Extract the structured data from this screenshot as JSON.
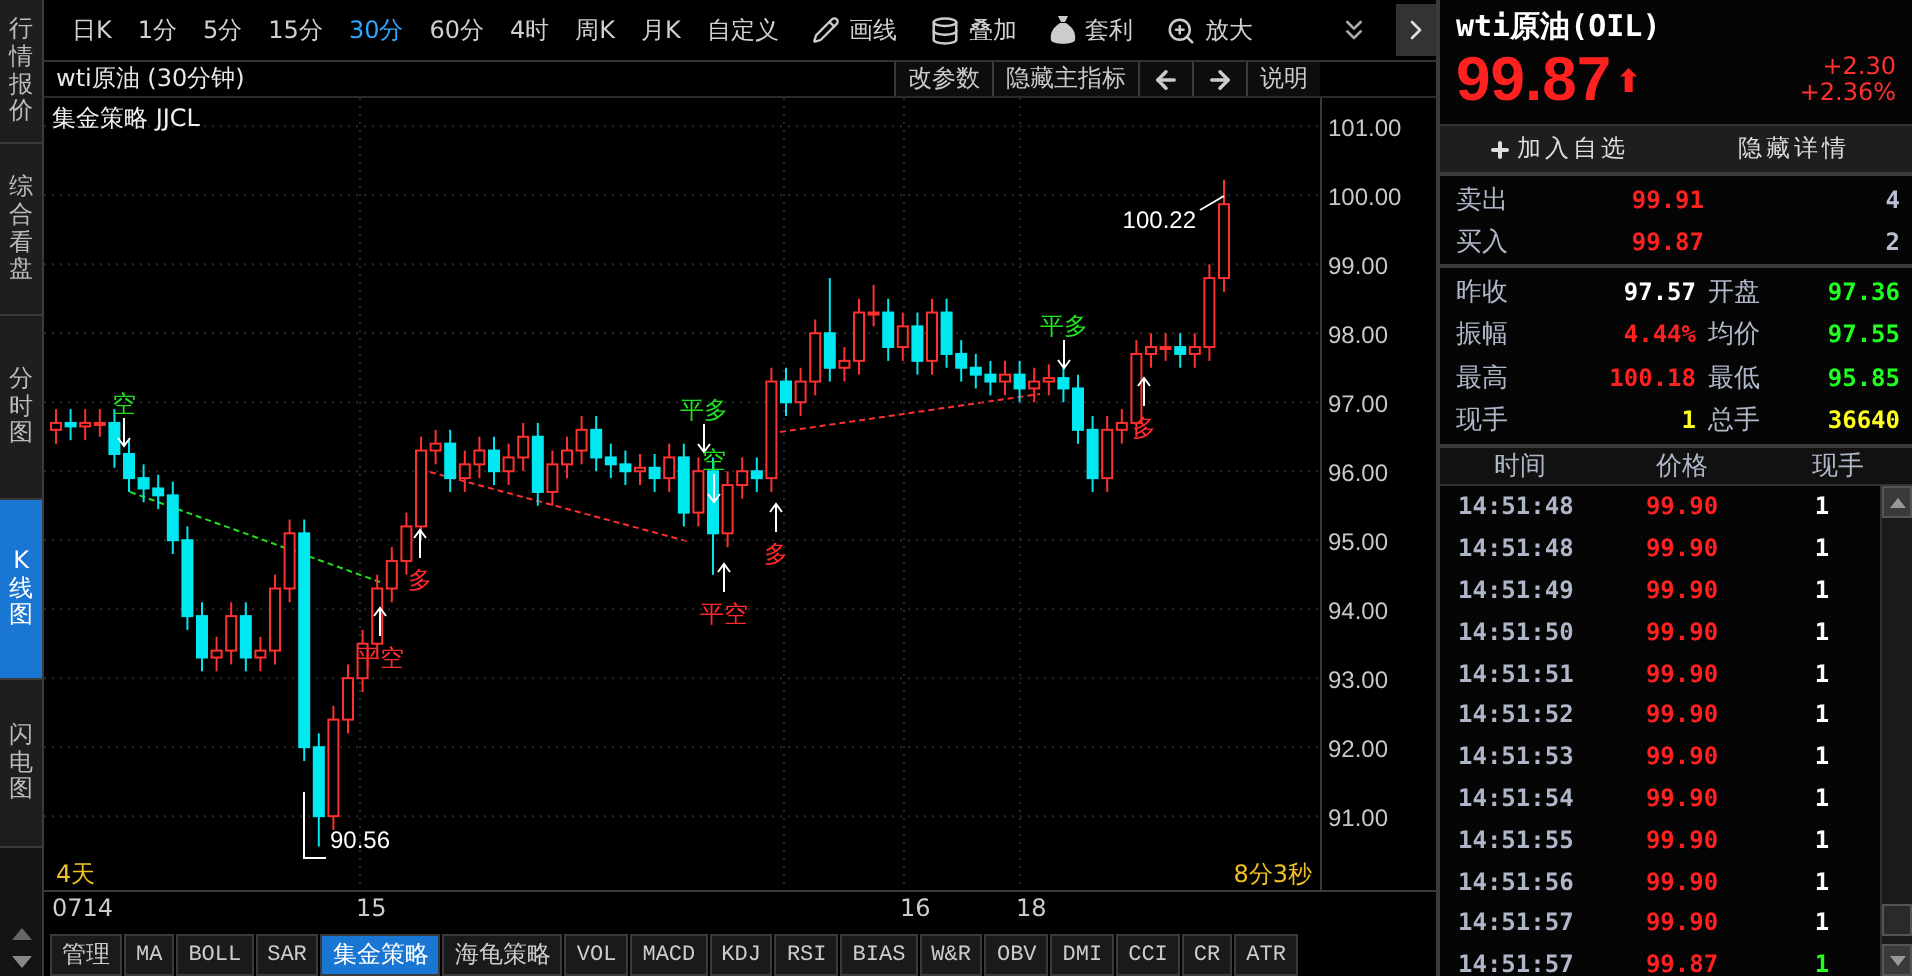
{
  "sidebar_tabs": [
    {
      "label": "行情报价",
      "selected": false
    },
    {
      "label": "综合看盘",
      "selected": false
    },
    {
      "label": "分时图",
      "selected": false
    },
    {
      "label": "K线图",
      "selected": true
    },
    {
      "label": "闪电图",
      "selected": false
    }
  ],
  "periods": [
    {
      "label": "日K",
      "selected": false
    },
    {
      "label": "1分",
      "selected": false
    },
    {
      "label": "5分",
      "selected": false
    },
    {
      "label": "15分",
      "selected": false
    },
    {
      "label": "30分",
      "selected": true
    },
    {
      "label": "60分",
      "selected": false
    },
    {
      "label": "4时",
      "selected": false
    },
    {
      "label": "周K",
      "selected": false
    },
    {
      "label": "月K",
      "selected": false
    },
    {
      "label": "自定义",
      "selected": false
    }
  ],
  "tools": [
    {
      "label": "画线",
      "kind": "pen"
    },
    {
      "label": "叠加",
      "kind": "stack"
    },
    {
      "label": "套利",
      "kind": "bag"
    },
    {
      "label": "放大",
      "kind": "zoom"
    }
  ],
  "chart": {
    "title": "wti原油 (30分钟)",
    "buttons": [
      {
        "kind": "text",
        "label": "改参数"
      },
      {
        "kind": "text",
        "label": "隐藏主指标"
      },
      {
        "kind": "left"
      },
      {
        "kind": "right"
      },
      {
        "kind": "text",
        "label": "说明"
      }
    ],
    "indicator": "集金策略 JJCL",
    "high_label": "100.22",
    "low_label": "90.56",
    "signals": [
      {
        "text": "空",
        "kind": "sell"
      },
      {
        "text": "平空",
        "kind": "buy"
      },
      {
        "text": "多",
        "kind": "buy"
      },
      {
        "text": "平多",
        "kind": "sell"
      },
      {
        "text": "空",
        "kind": "sell"
      },
      {
        "text": "平空",
        "kind": "buy"
      },
      {
        "text": "多",
        "kind": "buy"
      },
      {
        "text": "平多",
        "kind": "sell"
      },
      {
        "text": "多",
        "kind": "buy"
      }
    ],
    "span": "4天",
    "countdown": "8分3秒",
    "dates": [
      "0714",
      "15",
      "16",
      "18"
    ],
    "chart_data": {
      "type": "candlestick",
      "grid": true,
      "ylim": [
        89.93,
        101.41
      ],
      "ohlc": [
        [
          96.6,
          96.9,
          96.4,
          96.7
        ],
        [
          96.7,
          96.9,
          96.45,
          96.65
        ],
        [
          96.65,
          96.9,
          96.45,
          96.7
        ],
        [
          96.7,
          96.9,
          96.5,
          96.7
        ],
        [
          96.7,
          96.9,
          96.05,
          96.25
        ],
        [
          96.25,
          96.45,
          95.7,
          95.9
        ],
        [
          95.9,
          96.1,
          95.55,
          95.75
        ],
        [
          95.75,
          95.95,
          95.45,
          95.65
        ],
        [
          95.65,
          95.85,
          94.8,
          95.0
        ],
        [
          95.0,
          95.2,
          93.7,
          93.9
        ],
        [
          93.9,
          94.1,
          93.1,
          93.3
        ],
        [
          93.3,
          93.6,
          93.1,
          93.4
        ],
        [
          93.4,
          94.1,
          93.2,
          93.9
        ],
        [
          93.9,
          94.1,
          93.1,
          93.3
        ],
        [
          93.3,
          93.6,
          93.1,
          93.4
        ],
        [
          93.4,
          94.5,
          93.2,
          94.3
        ],
        [
          94.3,
          95.3,
          94.1,
          95.1
        ],
        [
          95.1,
          95.3,
          91.8,
          92.0
        ],
        [
          92.0,
          92.2,
          90.56,
          91.0
        ],
        [
          91.0,
          92.6,
          90.8,
          92.4
        ],
        [
          92.4,
          93.2,
          92.2,
          93.0
        ],
        [
          93.0,
          93.7,
          92.8,
          93.5
        ],
        [
          93.5,
          94.5,
          93.3,
          94.3
        ],
        [
          94.3,
          94.9,
          94.1,
          94.7
        ],
        [
          94.7,
          95.4,
          94.5,
          95.2
        ],
        [
          95.2,
          96.5,
          95.0,
          96.3
        ],
        [
          96.3,
          96.6,
          96.1,
          96.4
        ],
        [
          96.4,
          96.6,
          95.7,
          95.9
        ],
        [
          95.9,
          96.3,
          95.7,
          96.1
        ],
        [
          96.1,
          96.5,
          95.9,
          96.3
        ],
        [
          96.3,
          96.5,
          95.8,
          96.0
        ],
        [
          96.0,
          96.4,
          95.8,
          96.2
        ],
        [
          96.2,
          96.7,
          96.0,
          96.5
        ],
        [
          96.5,
          96.7,
          95.5,
          95.7
        ],
        [
          95.7,
          96.3,
          95.5,
          96.1
        ],
        [
          96.1,
          96.5,
          95.9,
          96.3
        ],
        [
          96.3,
          96.8,
          96.1,
          96.6
        ],
        [
          96.6,
          96.8,
          96.0,
          96.2
        ],
        [
          96.2,
          96.4,
          95.9,
          96.1
        ],
        [
          96.1,
          96.3,
          95.8,
          96.0
        ],
        [
          96.0,
          96.25,
          95.8,
          96.05
        ],
        [
          96.05,
          96.25,
          95.7,
          95.9
        ],
        [
          95.9,
          96.4,
          95.7,
          96.2
        ],
        [
          96.2,
          96.4,
          95.2,
          95.4
        ],
        [
          95.4,
          96.2,
          95.2,
          96.0
        ],
        [
          96.0,
          96.2,
          94.5,
          95.1
        ],
        [
          95.1,
          96.0,
          94.9,
          95.8
        ],
        [
          95.8,
          96.2,
          95.6,
          96.0
        ],
        [
          96.0,
          96.2,
          95.7,
          95.9
        ],
        [
          95.9,
          97.5,
          95.7,
          97.3
        ],
        [
          97.3,
          97.5,
          96.8,
          97.0
        ],
        [
          97.0,
          97.5,
          96.8,
          97.3
        ],
        [
          97.3,
          98.2,
          97.1,
          98.0
        ],
        [
          98.0,
          98.8,
          97.3,
          97.5
        ],
        [
          97.5,
          97.8,
          97.3,
          97.6
        ],
        [
          97.6,
          98.5,
          97.4,
          98.3
        ],
        [
          98.3,
          98.7,
          98.1,
          98.3
        ],
        [
          98.3,
          98.5,
          97.6,
          97.8
        ],
        [
          97.8,
          98.3,
          97.6,
          98.1
        ],
        [
          98.1,
          98.3,
          97.4,
          97.6
        ],
        [
          97.6,
          98.5,
          97.4,
          98.3
        ],
        [
          98.3,
          98.5,
          97.5,
          97.7
        ],
        [
          97.7,
          97.9,
          97.3,
          97.5
        ],
        [
          97.5,
          97.7,
          97.2,
          97.4
        ],
        [
          97.4,
          97.6,
          97.1,
          97.3
        ],
        [
          97.3,
          97.6,
          97.1,
          97.4
        ],
        [
          97.4,
          97.6,
          97.0,
          97.2
        ],
        [
          97.2,
          97.5,
          97.0,
          97.3
        ],
        [
          97.3,
          97.55,
          97.1,
          97.35
        ],
        [
          97.35,
          97.55,
          97.0,
          97.2
        ],
        [
          97.2,
          97.4,
          96.4,
          96.6
        ],
        [
          96.6,
          96.8,
          95.7,
          95.9
        ],
        [
          95.9,
          96.8,
          95.7,
          96.6
        ],
        [
          96.6,
          96.9,
          96.4,
          96.7
        ],
        [
          96.7,
          97.9,
          96.5,
          97.7
        ],
        [
          97.7,
          98.0,
          97.5,
          97.8
        ],
        [
          97.8,
          98.0,
          97.6,
          97.8
        ],
        [
          97.8,
          98.0,
          97.5,
          97.7
        ],
        [
          97.7,
          98.0,
          97.5,
          97.8
        ],
        [
          97.8,
          99.0,
          97.6,
          98.8
        ],
        [
          98.8,
          100.22,
          98.6,
          99.87
        ]
      ],
      "yticks": [
        {
          "value": 101,
          "label": "101.00"
        },
        {
          "value": 100,
          "label": "100.00"
        },
        {
          "value": 99,
          "label": "99.00"
        },
        {
          "value": 98,
          "label": "98.00"
        },
        {
          "value": 97,
          "label": "97.00"
        },
        {
          "value": 96,
          "label": "96.00"
        },
        {
          "value": 95,
          "label": "95.00"
        },
        {
          "value": 94,
          "label": "94.00"
        },
        {
          "value": 93,
          "label": "93.00"
        },
        {
          "value": 92,
          "label": "92.00"
        },
        {
          "value": 91,
          "label": "91.00"
        }
      ]
    }
  },
  "indicator_tabs": [
    {
      "label": "管理",
      "selected": false
    },
    {
      "label": "MA",
      "selected": false
    },
    {
      "label": "BOLL",
      "selected": false
    },
    {
      "label": "SAR",
      "selected": false
    },
    {
      "label": "集金策略",
      "selected": true
    },
    {
      "label": "海龟策略",
      "selected": false
    },
    {
      "label": "VOL",
      "selected": false
    },
    {
      "label": "MACD",
      "selected": false
    },
    {
      "label": "KDJ",
      "selected": false
    },
    {
      "label": "RSI",
      "selected": false
    },
    {
      "label": "BIAS",
      "selected": false
    },
    {
      "label": "W&R",
      "selected": false
    },
    {
      "label": "OBV",
      "selected": false
    },
    {
      "label": "DMI",
      "selected": false
    },
    {
      "label": "CCI",
      "selected": false
    },
    {
      "label": "CR",
      "selected": false
    },
    {
      "label": "ATR",
      "selected": false
    }
  ],
  "quote": {
    "name": "wti原油(OIL)",
    "price": "99.87",
    "arrow": "⬆",
    "change": "+2.30",
    "change_pct": "+2.36%",
    "actions": [
      "加入自选",
      "隐藏详情"
    ]
  },
  "book": [
    {
      "label": "卖出",
      "price": "99.91",
      "volume": "4"
    },
    {
      "label": "买入",
      "price": "99.87",
      "volume": "2"
    }
  ],
  "stats": [
    {
      "label": "昨收",
      "value": "97.57",
      "color": "#ffffff"
    },
    {
      "label": "开盘",
      "value": "97.36",
      "color": "#20ff20"
    },
    {
      "label": "振幅",
      "value": "4.44%",
      "color": "#ff2020"
    },
    {
      "label": "均价",
      "value": "97.55",
      "color": "#20ff20"
    },
    {
      "label": "最高",
      "value": "100.18",
      "color": "#ff2020"
    },
    {
      "label": "最低",
      "value": "95.85",
      "color": "#20ff20"
    },
    {
      "label": "现手",
      "value": "1",
      "color": "#ffff20"
    },
    {
      "label": "总手",
      "value": "36640",
      "color": "#ffff20"
    }
  ],
  "ticks_header": [
    "时间",
    "价格",
    "现手"
  ],
  "ticks": [
    {
      "time": "14:51:48",
      "price": "99.90",
      "volume": "1",
      "color": "#ffffff"
    },
    {
      "time": "14:51:48",
      "price": "99.90",
      "volume": "1",
      "color": "#ffffff"
    },
    {
      "time": "14:51:49",
      "price": "99.90",
      "volume": "1",
      "color": "#ffffff"
    },
    {
      "time": "14:51:50",
      "price": "99.90",
      "volume": "1",
      "color": "#ffffff"
    },
    {
      "time": "14:51:51",
      "price": "99.90",
      "volume": "1",
      "color": "#ffffff"
    },
    {
      "time": "14:51:52",
      "price": "99.90",
      "volume": "1",
      "color": "#ffffff"
    },
    {
      "time": "14:51:53",
      "price": "99.90",
      "volume": "1",
      "color": "#ffffff"
    },
    {
      "time": "14:51:54",
      "price": "99.90",
      "volume": "1",
      "color": "#ffffff"
    },
    {
      "time": "14:51:55",
      "price": "99.90",
      "volume": "1",
      "color": "#ffffff"
    },
    {
      "time": "14:51:56",
      "price": "99.90",
      "volume": "1",
      "color": "#ffffff"
    },
    {
      "time": "14:51:57",
      "price": "99.90",
      "volume": "1",
      "color": "#ffffff"
    },
    {
      "time": "14:51:57",
      "price": "99.87",
      "volume": "1",
      "color": "#20ff20"
    }
  ]
}
